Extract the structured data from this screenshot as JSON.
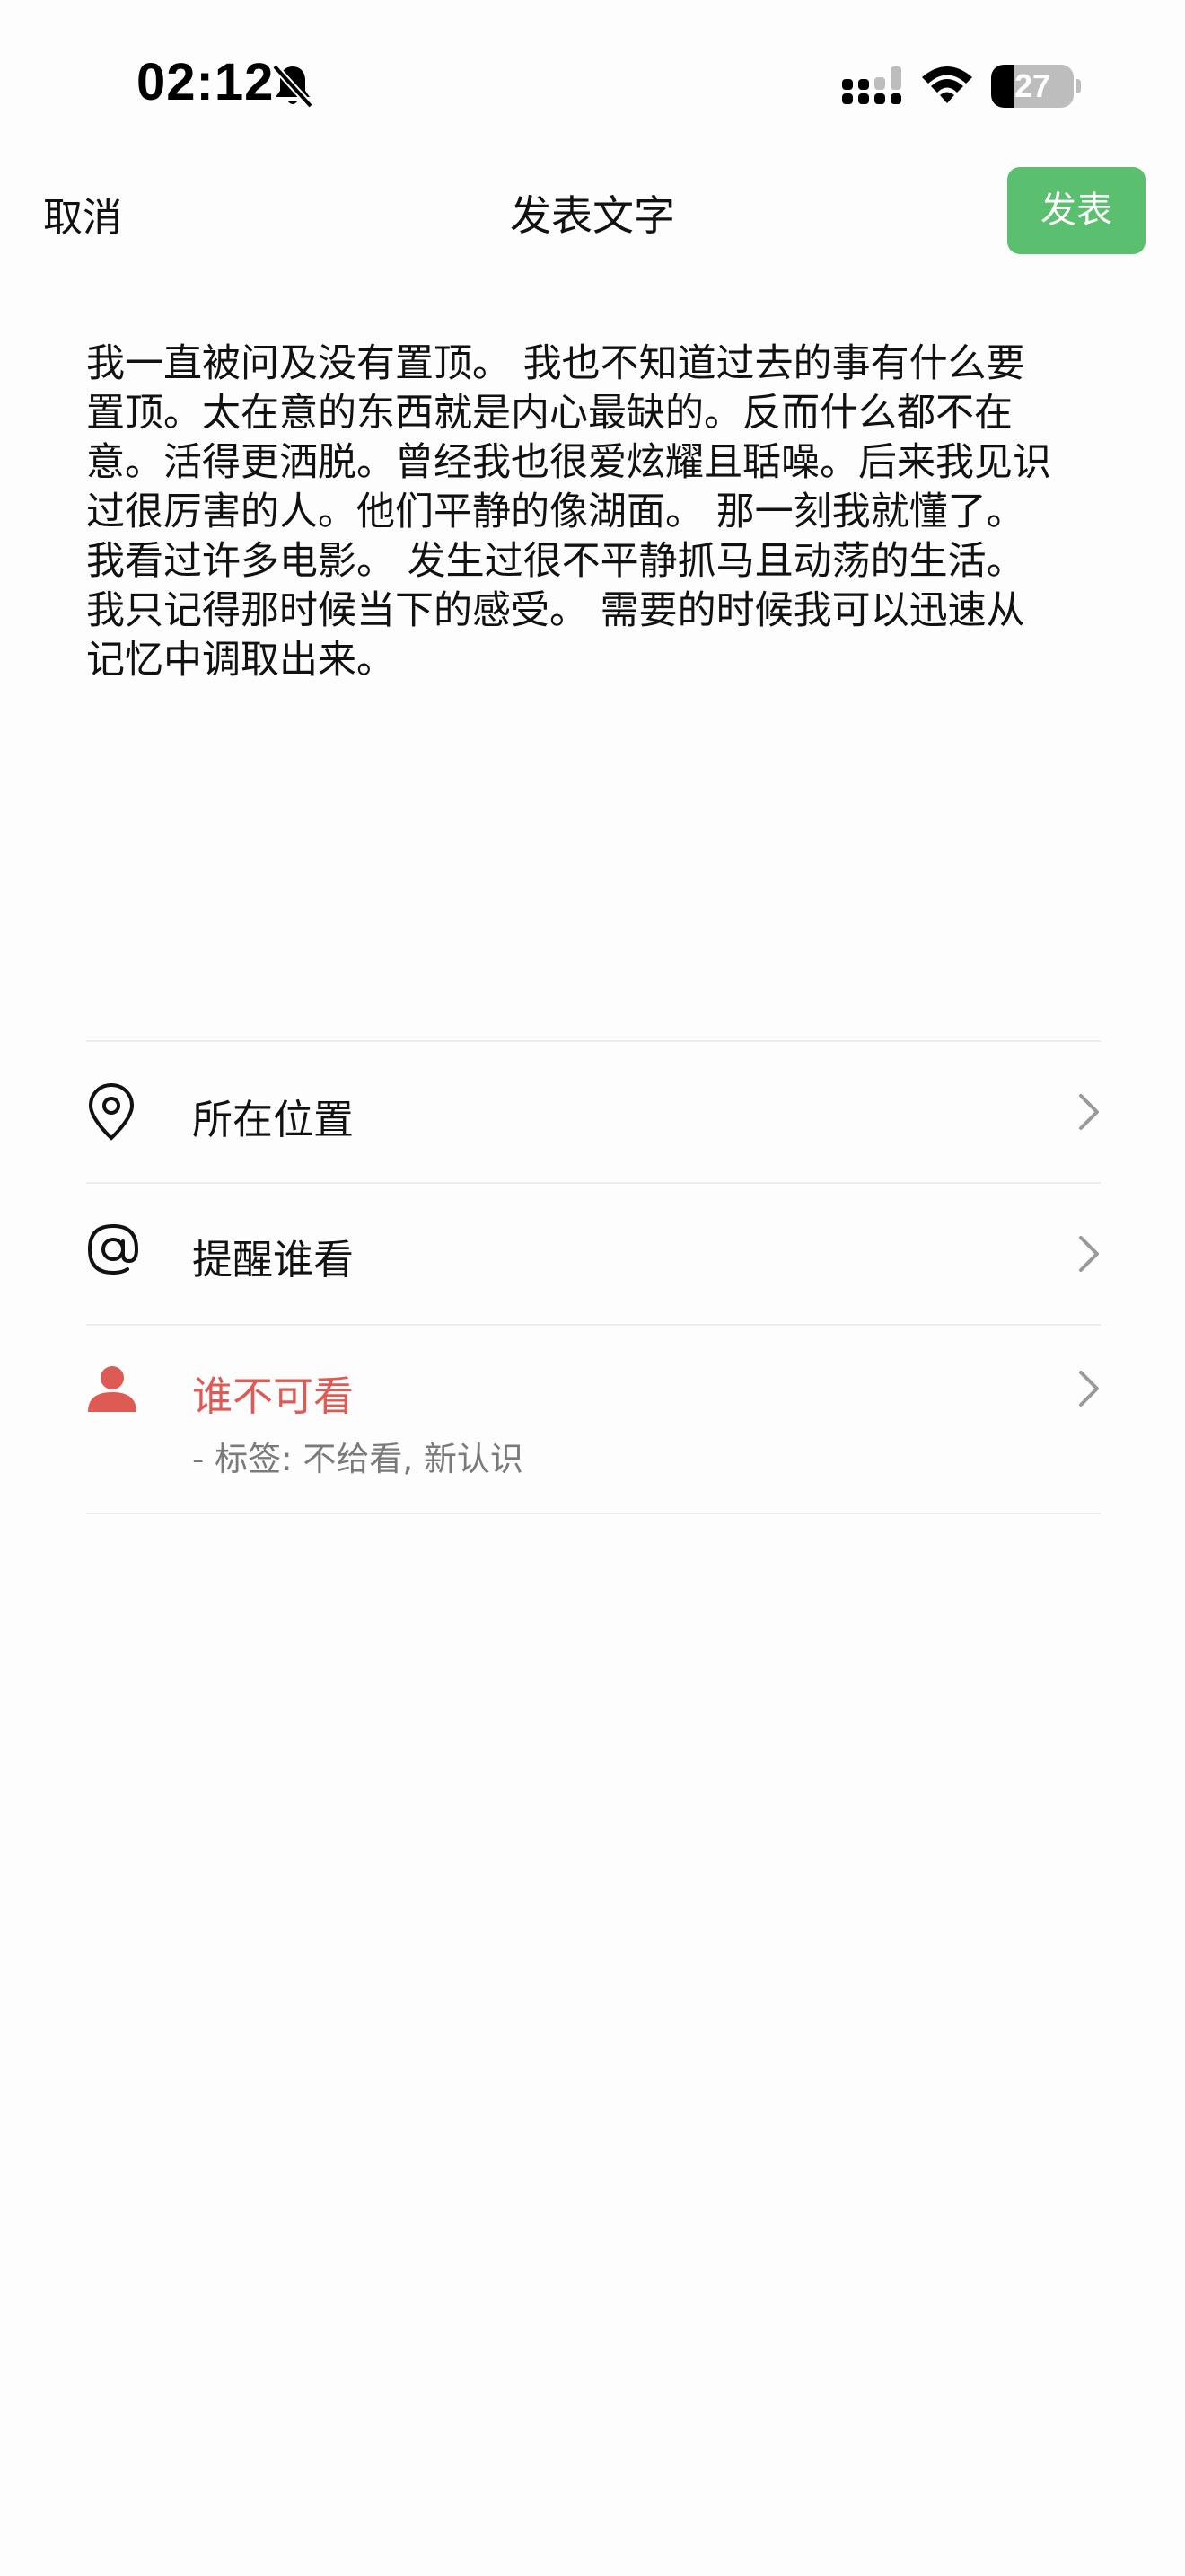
{
  "status_bar": {
    "time": "02:12",
    "battery_level": "27",
    "battery_fraction": 0.27,
    "icons": [
      "bell-slash-icon",
      "cellular-signal-icon",
      "wifi-icon",
      "battery-icon"
    ]
  },
  "nav": {
    "cancel_label": "取消",
    "title": "发表文字",
    "post_label": "发表"
  },
  "post": {
    "lines": [
      "我一直被问及没有置顶。 我也不知道过去的事有什么要",
      "置顶。太在意的东西就是内心最缺的。反而什么都不在",
      "意。活得更洒脱。曾经我也很爱炫耀且聒噪。后来我见识",
      "过很厉害的人。他们平静的像湖面。 那一刻我就懂了。",
      "我看过许多电影。 发生过很不平静抓马且动荡的生活。",
      "我只记得那时候当下的感受。 需要的时候我可以迅速从",
      "记忆中调取出来。"
    ]
  },
  "options": {
    "location": {
      "label": "所在位置",
      "icon": "location-pin-icon"
    },
    "mention": {
      "label": "提醒谁看",
      "icon": "at-sign-icon"
    },
    "privacy": {
      "label": "谁不可看",
      "sub": "- 标签: 不给看, 新认识",
      "icon": "person-icon"
    }
  },
  "colors": {
    "accent_green": "#5ABF6E",
    "privacy_red": "#DE5A55",
    "divider": "#ECECEC",
    "background": "#FDFDFD"
  }
}
